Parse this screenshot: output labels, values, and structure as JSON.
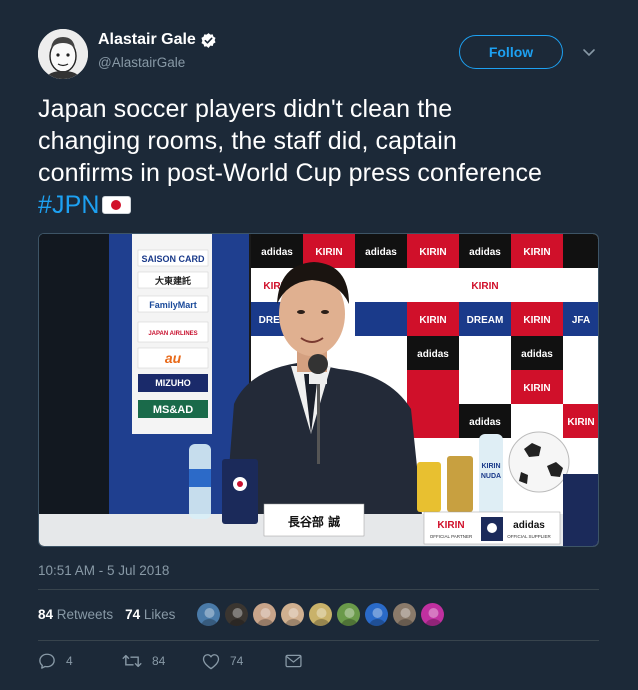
{
  "author": {
    "display_name": "Alastair Gale",
    "handle": "@AlastairGale",
    "verified": true,
    "avatar_icon": "avatar-portrait"
  },
  "follow_button": {
    "label": "Follow"
  },
  "tweet": {
    "text_lines": [
      "Japan soccer players didn't clean the",
      "changing rooms, the staff did, captain",
      "confirms in post-World Cup press conference"
    ],
    "hashtag": "#JPN",
    "emoji": "japan-flag"
  },
  "media": {
    "sponsor_board_left": [
      "SAISON CARD",
      "大東建託",
      "FamilyMart",
      "JAPAN AIRLINES",
      "au",
      "MIZUHO",
      "MS&AD"
    ],
    "sponsor_board_right": [
      "adidas",
      "KIRIN",
      "DREAM",
      "JFA"
    ],
    "nameplate": "長谷部 誠",
    "table_banner": [
      "KIRIN",
      "adidas"
    ],
    "table_banner_sub": [
      "OFFICIAL PARTNER",
      "OFFICIAL SUPPLIER"
    ],
    "bottle_label": [
      "KIRIN",
      "NUDA"
    ]
  },
  "timestamp": "10:51 AM - 5 Jul 2018",
  "stats": {
    "retweets_count": "84",
    "retweets_label": "Retweets",
    "likes_count": "74",
    "likes_label": "Likes",
    "likers": [
      {
        "icon": "liker-avatar-1",
        "color": "#4a7aa8"
      },
      {
        "icon": "liker-avatar-2",
        "color": "#3a3530"
      },
      {
        "icon": "liker-avatar-3",
        "color": "#c8a48a"
      },
      {
        "icon": "liker-avatar-4",
        "color": "#d0b090"
      },
      {
        "icon": "liker-avatar-5",
        "color": "#c9b26a"
      },
      {
        "icon": "liker-avatar-6",
        "color": "#6a9a4a"
      },
      {
        "icon": "liker-avatar-7",
        "color": "#2a6ac8"
      },
      {
        "icon": "liker-avatar-8",
        "color": "#8a7a6a"
      },
      {
        "icon": "liker-avatar-9",
        "color": "#c030a0"
      }
    ]
  },
  "actions": {
    "reply_count": "4",
    "retweet_count": "84",
    "like_count": "74"
  },
  "colors": {
    "background": "#1c2938",
    "accent": "#1da1f2",
    "muted": "#8899a6",
    "divider": "#38444d"
  }
}
